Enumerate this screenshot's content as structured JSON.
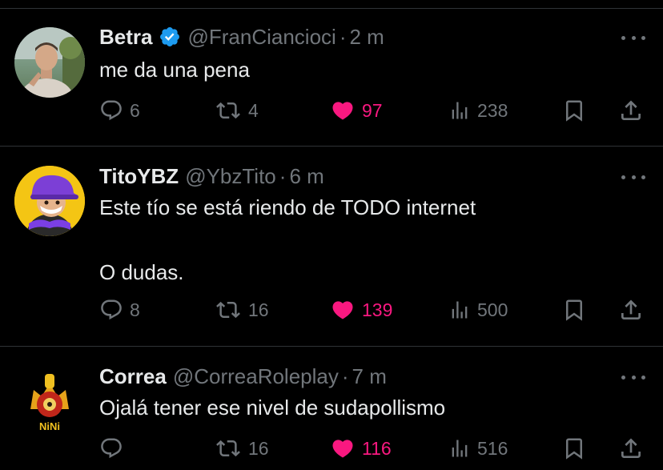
{
  "replies": [
    {
      "name": "Betra",
      "verified": true,
      "handle": "@FranCiancioci",
      "separator": "·",
      "time": "2 m",
      "text_lines": [
        "me da una pena"
      ],
      "stats": {
        "replies": "6",
        "reposts": "4",
        "likes": "97",
        "views": "238"
      },
      "liked": true
    },
    {
      "name": "TitoYBZ",
      "verified": false,
      "handle": "@YbzTito",
      "separator": "·",
      "time": "6 m",
      "text_lines": [
        "Este tío se está riendo de TODO internet",
        "",
        "O dudas."
      ],
      "stats": {
        "replies": "8",
        "reposts": "16",
        "likes": "139",
        "views": "500"
      },
      "liked": true
    },
    {
      "name": "Correa",
      "verified": false,
      "handle": "@CorreaRoleplay",
      "separator": "·",
      "time": "7 m",
      "text_lines": [
        "Ojalá tener ese nivel de sudapollismo"
      ],
      "stats": {
        "replies": "",
        "reposts": "16",
        "likes": "116",
        "views": "516"
      },
      "liked": true,
      "avatar_text": "NiNi"
    }
  ],
  "icons": {
    "reply": "speech-bubble-icon",
    "repost": "repost-arrows-icon",
    "like": "heart-icon",
    "views": "bar-chart-icon",
    "bookmark": "bookmark-icon",
    "share": "share-upload-icon",
    "more": "ellipsis-icon",
    "verified": "verified-badge-icon"
  },
  "colors": {
    "background": "#000000",
    "text": "#e7e9ea",
    "muted": "#71767b",
    "like": "#f91880",
    "verified": "#1d9bf0",
    "divider": "#2f3336"
  }
}
